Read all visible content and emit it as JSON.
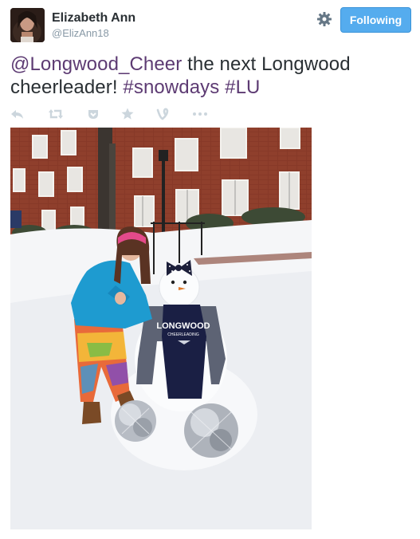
{
  "user": {
    "name": "Elizabeth Ann",
    "handle": "@ElizAnn18"
  },
  "follow_button": {
    "label": "Following",
    "color": "#55acee"
  },
  "tweet": {
    "mention": "@Longwood_Cheer",
    "text_main": "  the next Longwood cheerleader! ",
    "hashtag1": "#snowdays",
    "space": " ",
    "hashtag2": "#LU",
    "link_color": "#5d3b73"
  },
  "actions": [
    "reply-icon",
    "retweet-icon",
    "pocket-icon",
    "favorite-icon",
    "vine-icon",
    "more-icon"
  ],
  "photo": {
    "shirt_text": "LONGWOOD",
    "shirt_subtext": "CHEERLEADING"
  }
}
